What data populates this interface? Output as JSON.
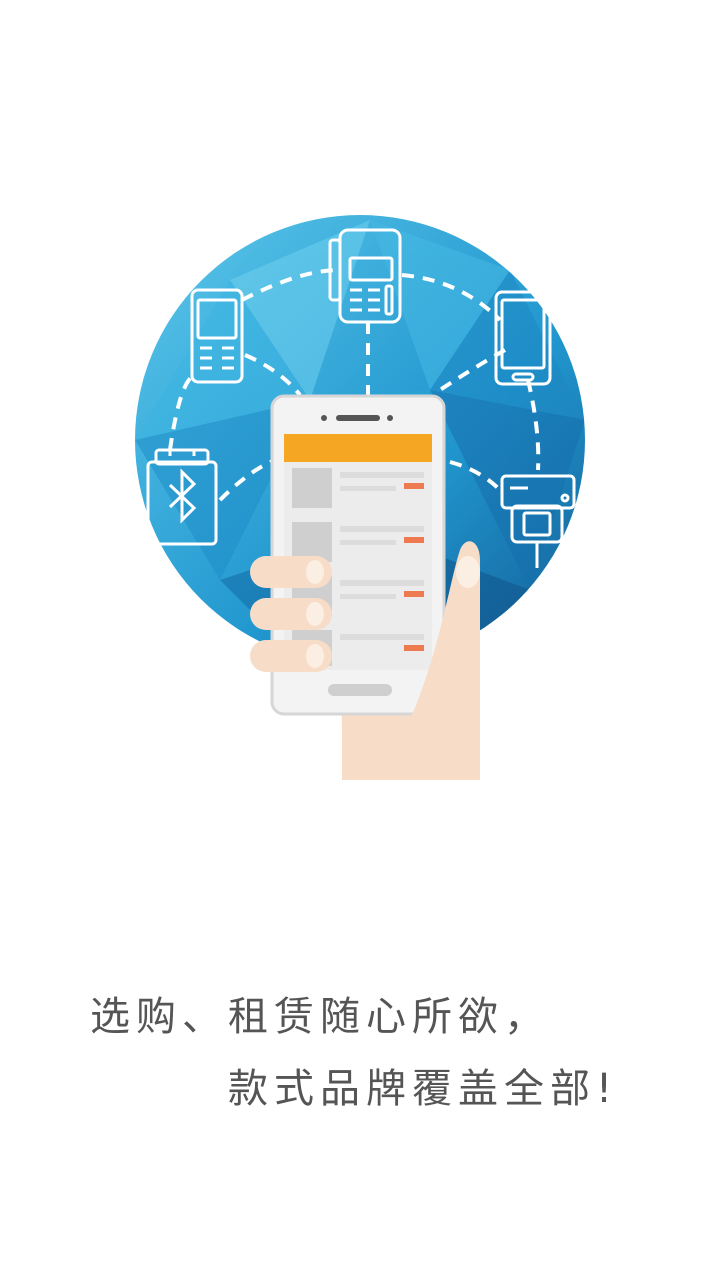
{
  "onboarding": {
    "illustration": {
      "icon_names": [
        "globe-icon",
        "pos-terminal-icon",
        "feature-phone-icon",
        "smartphone-icon",
        "bluetooth-device-icon",
        "card-reader-icon",
        "phone-in-hand-icon"
      ],
      "colors": {
        "globe": "#2ea8d8",
        "globe_dark": "#1b6fa8",
        "phone_header": "#f5a623",
        "price_tag": "#ef7a52",
        "hand": "#f7dcc8"
      }
    },
    "tagline": {
      "line1": "选购、租赁随心所欲，",
      "line2": "款式品牌覆盖全部!"
    }
  }
}
